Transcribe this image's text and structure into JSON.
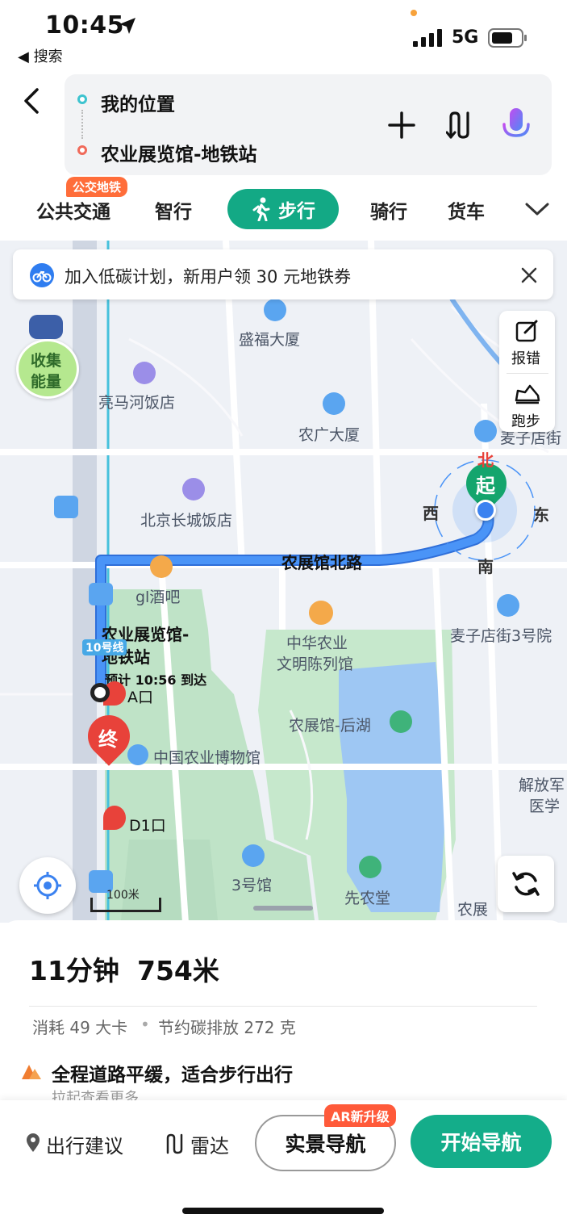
{
  "status_bar": {
    "time": "10:45",
    "back_app": "◀ 搜索",
    "network": "5G"
  },
  "route": {
    "origin": "我的位置",
    "destination": "农业展览馆-地铁站"
  },
  "tabs": {
    "transit": "公共交通",
    "transit_badge": "公交地铁",
    "smart": "智行",
    "walk": "步行",
    "bike": "骑行",
    "truck": "货车"
  },
  "banner": {
    "text": "加入低碳计划，新用户领 30 元地铁券"
  },
  "side_tools": {
    "report": "报错",
    "run": "跑步"
  },
  "energy": {
    "label_line1": "收集",
    "label_line2": "能量"
  },
  "map": {
    "labels": {
      "shengfu": "盛福大厦",
      "liangma": "亮马河饭店",
      "nongguang": "农广大厦",
      "changcheng": "北京长城饭店",
      "mai_zidian_top": "麦子店街",
      "road": "农展馆北路",
      "gl": "gl酒吧",
      "zhonghua1": "中华农业",
      "zhonghua2": "文明陈列馆",
      "maizi3": "麦子店街3号院",
      "station1": "农业展览馆-",
      "station2": "地铁站",
      "eta": "预计 10:56 到达",
      "exit_a": "A口",
      "houhu": "农展馆-后湖",
      "museum": "中国农业博物馆",
      "jiefang1": "解放军",
      "jiefang2": "医学",
      "d1": "D1口",
      "hall3": "3号馆",
      "xiannong": "先农堂",
      "nongzhan": "农展",
      "line10": "10号线",
      "scale": "100米",
      "end": "终",
      "start": "起",
      "north": "北",
      "south": "南",
      "east": "东",
      "west": "西"
    }
  },
  "summary": {
    "time": "11分钟",
    "distance": "754米",
    "calories": "消耗 49 大卡",
    "carbon": "节约碳排放 272 克",
    "tip": "全程道路平缓，适合步行出行",
    "more": "拉起查看更多"
  },
  "bottom_bar": {
    "advice": "出行建议",
    "radar": "雷达",
    "ar_nav": "实景导航",
    "ar_badge": "AR新升级",
    "start_nav": "开始导航"
  },
  "colors": {
    "accent": "#13a985",
    "route": "#3f8cf6",
    "end_marker": "#e8423a",
    "badge": "#ff6d3a"
  }
}
